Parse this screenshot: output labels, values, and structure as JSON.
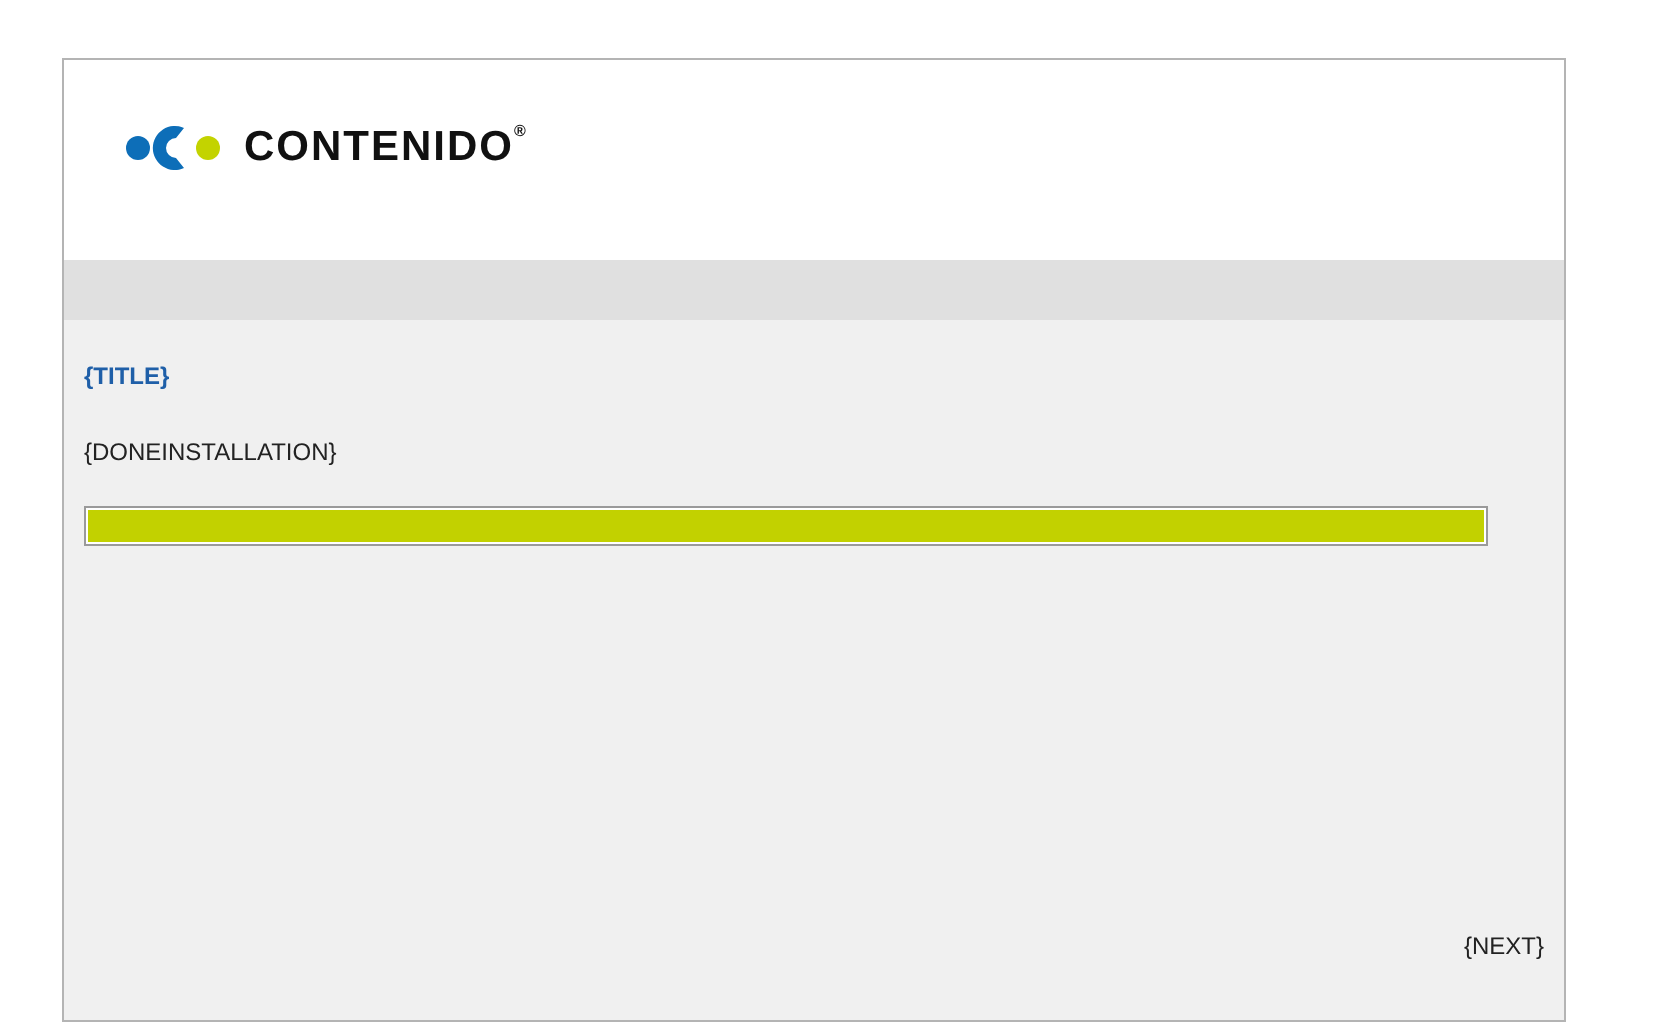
{
  "logo": {
    "text": "CONTENIDO",
    "mark": "®"
  },
  "title": "{TITLE}",
  "message": "{DONEINSTALLATION}",
  "progress": {
    "level": 1
  },
  "next_link": "{NEXT}"
}
